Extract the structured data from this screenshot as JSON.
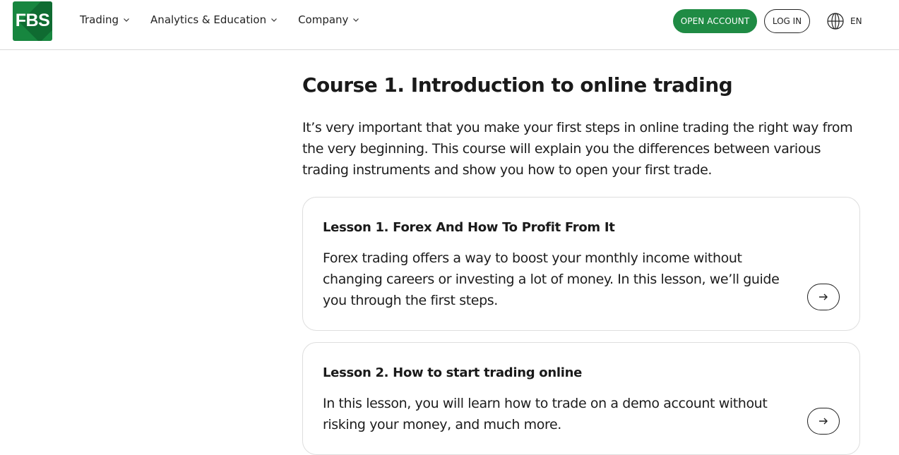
{
  "header": {
    "logo_text": "FBS",
    "nav": [
      {
        "label": "Trading",
        "icon": "chevron-down-icon"
      },
      {
        "label": "Analytics & Education",
        "icon": "chevron-down-icon"
      },
      {
        "label": "Company",
        "icon": "chevron-down-icon"
      }
    ],
    "open_account_label": "OPEN ACCOUNT",
    "login_label": "LOG IN",
    "language": "EN",
    "brand_color": "#1f8b44"
  },
  "main": {
    "course_title": "Course 1. Introduction to online trading",
    "course_description": "It’s very important that you make your first steps in online trading the right way from the very beginning. This course will explain you the differences between various trading instruments and show you how to open your first trade.",
    "lessons": [
      {
        "title": "Lesson 1. Forex And How To Profit From It",
        "text": "Forex trading offers a way to boost your monthly income without changing careers or investing a lot of money. In this lesson, we’ll guide you through the first steps.",
        "icon": "arrow-right-icon"
      },
      {
        "title": "Lesson 2. How to start trading online",
        "text": "In this lesson, you will learn how to trade on a demo account without risking your money, and much more.",
        "icon": "arrow-right-icon"
      }
    ]
  }
}
